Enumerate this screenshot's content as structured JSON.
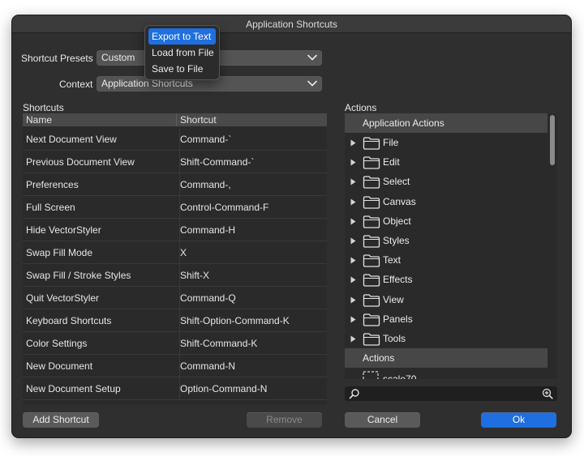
{
  "window": {
    "title": "Application Shortcuts"
  },
  "presets": {
    "label": "Shortcut Presets",
    "value": "Custom"
  },
  "context": {
    "label": "Context",
    "value": "Application Shortcuts"
  },
  "presets_menu": {
    "items": [
      "Export to Text",
      "Load from File",
      "Save to File"
    ],
    "selected_index": 0
  },
  "shortcuts": {
    "label": "Shortcuts",
    "columns": [
      "Name",
      "Shortcut"
    ],
    "rows": [
      [
        "Next Document View",
        "Command-`"
      ],
      [
        "Previous Document View",
        "Shift-Command-`"
      ],
      [
        "Preferences",
        "Command-,"
      ],
      [
        "Full Screen",
        "Control-Command-F"
      ],
      [
        "Hide VectorStyler",
        "Command-H"
      ],
      [
        "Swap Fill Mode",
        "X"
      ],
      [
        "Swap Fill / Stroke Styles",
        "Shift-X"
      ],
      [
        "Quit VectorStyler",
        "Command-Q"
      ],
      [
        "Keyboard Shortcuts",
        "Shift-Option-Command-K"
      ],
      [
        "Color Settings",
        "Shift-Command-K"
      ],
      [
        "New Document",
        "Command-N"
      ],
      [
        "New Document Setup",
        "Option-Command-N"
      ]
    ]
  },
  "actions": {
    "label": "Actions",
    "group_title": "Application Actions",
    "items": [
      "File",
      "Edit",
      "Select",
      "Canvas",
      "Object",
      "Styles",
      "Text",
      "Effects",
      "View",
      "Panels",
      "Tools"
    ],
    "second_group_title": "Actions",
    "partial_item": "scale70"
  },
  "buttons": {
    "add": "Add Shortcut",
    "remove": "Remove",
    "cancel": "Cancel",
    "ok": "Ok"
  },
  "colors": {
    "accent": "#1f6fe0",
    "window_bg": "#2f2f2f",
    "header_bg": "#474747"
  },
  "icons": {
    "folder": "folder-icon",
    "disclosure": "disclosure-triangle-icon",
    "search": "search-icon",
    "zoom": "zoom-in-icon",
    "dropdown": "chevron-down-icon"
  }
}
